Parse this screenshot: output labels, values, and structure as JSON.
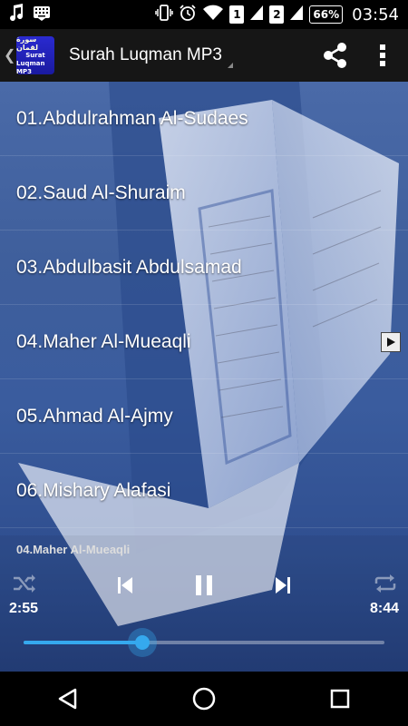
{
  "status_bar": {
    "left_icons": [
      "music-note-icon",
      "keyboard-icon"
    ],
    "sim1": "1",
    "sim2": "2",
    "battery": "66%",
    "time": "03:54"
  },
  "app_bar": {
    "logo_lines": [
      "سورة لقمان",
      "Surat",
      "Luqman MP3"
    ],
    "title": "Surah Luqman MP3",
    "share_icon": "share-icon",
    "menu_icon": "overflow-menu-icon"
  },
  "tracks": [
    {
      "label": "01.Abdulrahman Al-Sudaes"
    },
    {
      "label": "02.Saud Al-Shuraim"
    },
    {
      "label": "03.Abdulbasit Abdulsamad"
    },
    {
      "label": "04.Maher Al-Mueaqli"
    },
    {
      "label": "05.Ahmad Al-Ajmy"
    },
    {
      "label": "06.Mishary Alafasi"
    }
  ],
  "now_playing_index": 3,
  "player": {
    "now_playing": "04.Maher Al-Mueaqli",
    "elapsed": "2:55",
    "total": "8:44",
    "progress": 0.33,
    "accent_color": "#35a9ee"
  },
  "nav": {
    "back_icon": "back-triangle-icon",
    "home_icon": "home-circle-icon",
    "recents_icon": "recents-square-icon"
  }
}
